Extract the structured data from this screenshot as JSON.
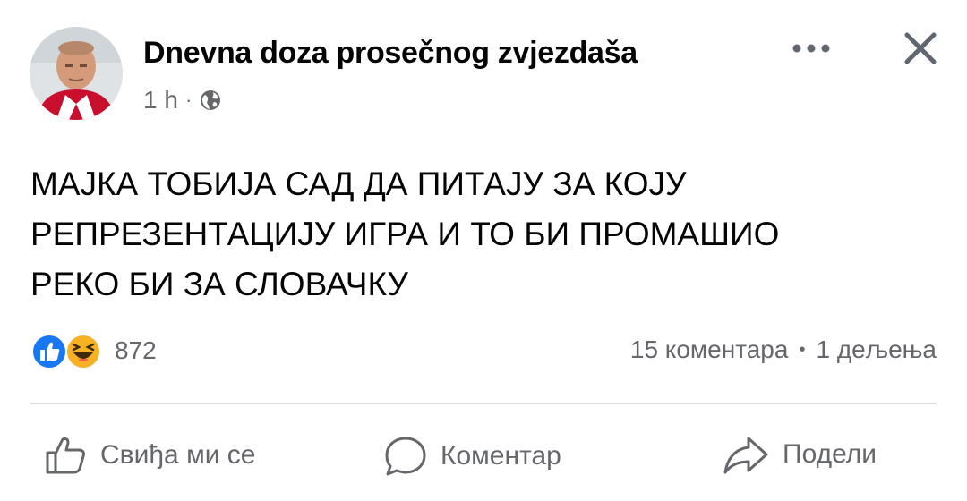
{
  "post": {
    "author": "Dnevna doza prosečnog zvjezdaša",
    "time": "1 h",
    "meta_separator": "·",
    "privacy_icon": "globe-icon",
    "text_lines": [
      "МАЈКА ТОБИЈА САД ДА ПИТАЈУ ЗА КОЈУ",
      "РЕПРЕЗЕНТАЦИЈУ ИГРА И ТО БИ ПРОМАШИО",
      "РЕКО БИ ЗА СЛОВАЧКУ"
    ]
  },
  "header": {
    "more_icon": "more-horizontal-icon",
    "close_icon": "close-icon"
  },
  "engagement": {
    "reaction_icons": [
      "like-reaction-icon",
      "haha-reaction-icon"
    ],
    "reaction_count": "872",
    "comments": "15 коментара",
    "separator": "•",
    "shares": "1 дељења"
  },
  "actions": {
    "like": "Свиђа ми се",
    "comment": "Коментар",
    "share": "Подели"
  },
  "colors": {
    "like_blue": "#1877f2",
    "haha_yellow": "#f7b125",
    "muted_text": "#65676b"
  }
}
